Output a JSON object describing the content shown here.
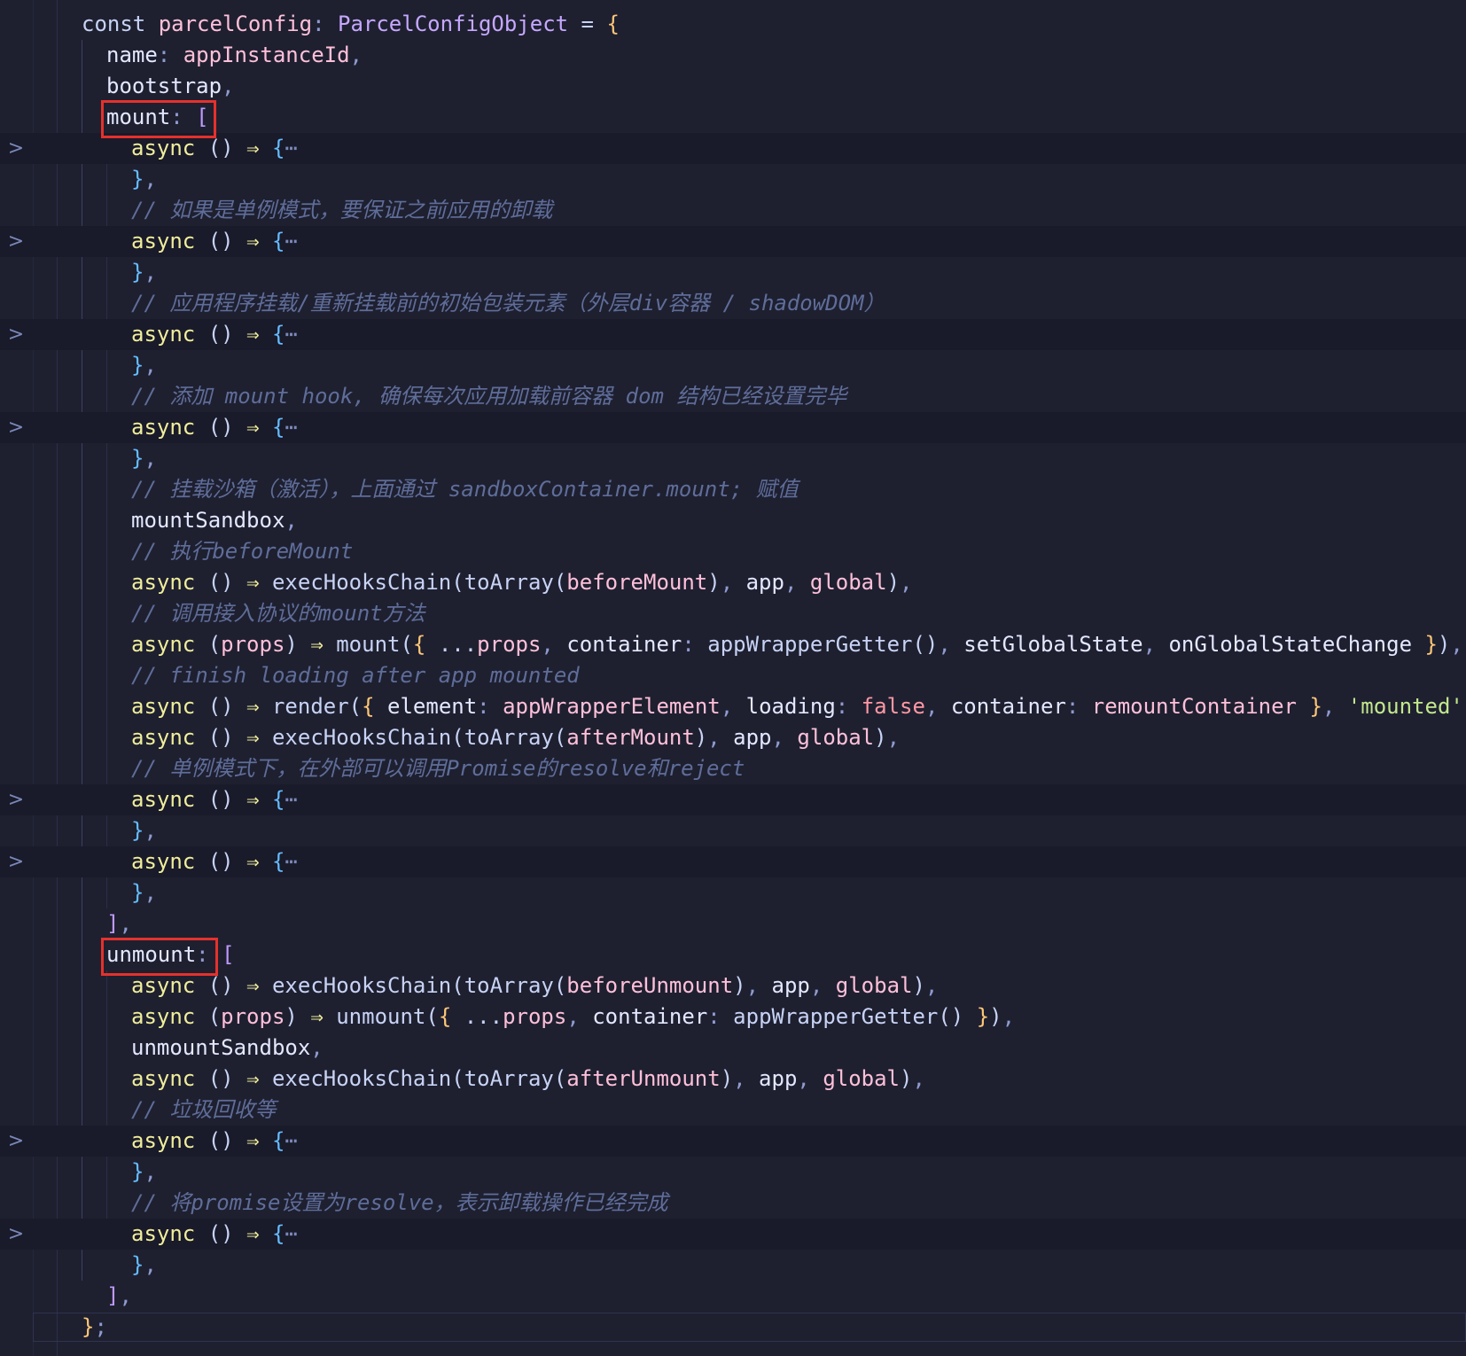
{
  "editor": {
    "lines": [
      {
        "fold": false,
        "indent": 0,
        "tokens": [
          [
            "k",
            "const "
          ],
          [
            "id",
            "parcelConfig"
          ],
          [
            "p",
            ": "
          ],
          [
            "ty",
            "ParcelConfigObject"
          ],
          [
            "k",
            " = "
          ],
          [
            "bk",
            "{"
          ]
        ]
      },
      {
        "fold": false,
        "indent": 1,
        "tokens": [
          [
            "txt-w",
            "name"
          ],
          [
            "p",
            ": "
          ],
          [
            "id",
            "appInstanceId"
          ],
          [
            "p",
            ","
          ]
        ]
      },
      {
        "fold": false,
        "indent": 1,
        "tokens": [
          [
            "txt-w",
            "bootstrap"
          ],
          [
            "p",
            ","
          ]
        ]
      },
      {
        "fold": false,
        "indent": 1,
        "tokens": [
          [
            "txt-w",
            "mount"
          ],
          [
            "p",
            ": "
          ],
          [
            "bk2",
            "["
          ]
        ]
      },
      {
        "fold": true,
        "indent": 2,
        "tokens": [
          [
            "kw",
            "async "
          ],
          [
            "k",
            "() "
          ],
          [
            "arrow",
            "⇒"
          ],
          [
            "k",
            " "
          ],
          [
            "bk3",
            "{"
          ],
          [
            "ell",
            "⋯"
          ]
        ]
      },
      {
        "fold": false,
        "indent": 2,
        "tokens": [
          [
            "bk3",
            "}"
          ],
          [
            "p",
            ","
          ]
        ]
      },
      {
        "fold": false,
        "indent": 2,
        "tokens": [
          [
            "cm",
            "// 如果是单例模式，要保证之前应用的卸载"
          ]
        ]
      },
      {
        "fold": true,
        "indent": 2,
        "tokens": [
          [
            "kw",
            "async "
          ],
          [
            "k",
            "() "
          ],
          [
            "arrow",
            "⇒"
          ],
          [
            "k",
            " "
          ],
          [
            "bk3",
            "{"
          ],
          [
            "ell",
            "⋯"
          ]
        ]
      },
      {
        "fold": false,
        "indent": 2,
        "tokens": [
          [
            "bk3",
            "}"
          ],
          [
            "p",
            ","
          ]
        ]
      },
      {
        "fold": false,
        "indent": 2,
        "tokens": [
          [
            "cm",
            "// 应用程序挂载/重新挂载前的初始包装元素（外层div容器 / shadowDOM）"
          ]
        ]
      },
      {
        "fold": true,
        "indent": 2,
        "tokens": [
          [
            "kw",
            "async "
          ],
          [
            "k",
            "() "
          ],
          [
            "arrow",
            "⇒"
          ],
          [
            "k",
            " "
          ],
          [
            "bk3",
            "{"
          ],
          [
            "ell",
            "⋯"
          ]
        ]
      },
      {
        "fold": false,
        "indent": 2,
        "tokens": [
          [
            "bk3",
            "}"
          ],
          [
            "p",
            ","
          ]
        ]
      },
      {
        "fold": false,
        "indent": 2,
        "tokens": [
          [
            "cm",
            "// 添加 mount hook, 确保每次应用加载前容器 dom 结构已经设置完毕"
          ]
        ]
      },
      {
        "fold": true,
        "indent": 2,
        "tokens": [
          [
            "kw",
            "async "
          ],
          [
            "k",
            "() "
          ],
          [
            "arrow",
            "⇒"
          ],
          [
            "k",
            " "
          ],
          [
            "bk3",
            "{"
          ],
          [
            "ell",
            "⋯"
          ]
        ]
      },
      {
        "fold": false,
        "indent": 2,
        "tokens": [
          [
            "bk3",
            "}"
          ],
          [
            "p",
            ","
          ]
        ]
      },
      {
        "fold": false,
        "indent": 2,
        "tokens": [
          [
            "cm",
            "// 挂载沙箱（激活），上面通过 sandboxContainer.mount; 赋值"
          ]
        ]
      },
      {
        "fold": false,
        "indent": 2,
        "tokens": [
          [
            "txt-w",
            "mountSandbox"
          ],
          [
            "p",
            ","
          ]
        ]
      },
      {
        "fold": false,
        "indent": 2,
        "tokens": [
          [
            "cm",
            "// 执行beforeMount"
          ]
        ]
      },
      {
        "fold": false,
        "indent": 2,
        "tokens": [
          [
            "kw",
            "async "
          ],
          [
            "k",
            "() "
          ],
          [
            "arrow",
            "⇒"
          ],
          [
            "k",
            " execHooksChain(toArray("
          ],
          [
            "id",
            "beforeMount"
          ],
          [
            "k",
            ")"
          ],
          [
            "p",
            ", "
          ],
          [
            "txt-w",
            "app"
          ],
          [
            "p",
            ", "
          ],
          [
            "id",
            "global"
          ],
          [
            "k",
            ")"
          ],
          [
            "p",
            ","
          ]
        ]
      },
      {
        "fold": false,
        "indent": 2,
        "tokens": [
          [
            "cm",
            "// 调用接入协议的mount方法"
          ]
        ]
      },
      {
        "fold": false,
        "indent": 2,
        "tokens": [
          [
            "kw",
            "async "
          ],
          [
            "k",
            "("
          ],
          [
            "id",
            "props"
          ],
          [
            "k",
            ") "
          ],
          [
            "arrow",
            "⇒"
          ],
          [
            "k",
            " mount("
          ],
          [
            "bk",
            "{"
          ],
          [
            "k",
            " ..."
          ],
          [
            "id",
            "props"
          ],
          [
            "p",
            ", "
          ],
          [
            "txt-w",
            "container"
          ],
          [
            "p",
            ": "
          ],
          [
            "k",
            "appWrapperGetter()"
          ],
          [
            "p",
            ", "
          ],
          [
            "txt-w",
            "setGlobalState"
          ],
          [
            "p",
            ", "
          ],
          [
            "txt-w",
            "onGlobalStateChange "
          ],
          [
            "bk",
            "}"
          ],
          [
            "k",
            ")"
          ],
          [
            "p",
            ","
          ]
        ]
      },
      {
        "fold": false,
        "indent": 2,
        "tokens": [
          [
            "cm",
            "// finish loading after app mounted"
          ]
        ]
      },
      {
        "fold": false,
        "indent": 2,
        "tokens": [
          [
            "kw",
            "async "
          ],
          [
            "k",
            "() "
          ],
          [
            "arrow",
            "⇒"
          ],
          [
            "k",
            " render("
          ],
          [
            "bk",
            "{"
          ],
          [
            "k",
            " "
          ],
          [
            "txt-w",
            "element"
          ],
          [
            "p",
            ": "
          ],
          [
            "id",
            "appWrapperElement"
          ],
          [
            "p",
            ", "
          ],
          [
            "txt-w",
            "loading"
          ],
          [
            "p",
            ": "
          ],
          [
            "bool",
            "false"
          ],
          [
            "p",
            ", "
          ],
          [
            "txt-w",
            "container"
          ],
          [
            "p",
            ": "
          ],
          [
            "id",
            "remountContainer "
          ],
          [
            "bk",
            "}"
          ],
          [
            "p",
            ", "
          ],
          [
            "st",
            "'mounted'"
          ],
          [
            "k",
            ")"
          ],
          [
            "p",
            ","
          ]
        ]
      },
      {
        "fold": false,
        "indent": 2,
        "tokens": [
          [
            "kw",
            "async "
          ],
          [
            "k",
            "() "
          ],
          [
            "arrow",
            "⇒"
          ],
          [
            "k",
            " execHooksChain(toArray("
          ],
          [
            "id",
            "afterMount"
          ],
          [
            "k",
            ")"
          ],
          [
            "p",
            ", "
          ],
          [
            "txt-w",
            "app"
          ],
          [
            "p",
            ", "
          ],
          [
            "id",
            "global"
          ],
          [
            "k",
            ")"
          ],
          [
            "p",
            ","
          ]
        ]
      },
      {
        "fold": false,
        "indent": 2,
        "tokens": [
          [
            "cm",
            "// 单例模式下，在外部可以调用Promise的resolve和reject"
          ]
        ]
      },
      {
        "fold": true,
        "indent": 2,
        "tokens": [
          [
            "kw",
            "async "
          ],
          [
            "k",
            "() "
          ],
          [
            "arrow",
            "⇒"
          ],
          [
            "k",
            " "
          ],
          [
            "bk3",
            "{"
          ],
          [
            "ell",
            "⋯"
          ]
        ]
      },
      {
        "fold": false,
        "indent": 2,
        "tokens": [
          [
            "bk3",
            "}"
          ],
          [
            "p",
            ","
          ]
        ]
      },
      {
        "fold": true,
        "indent": 2,
        "tokens": [
          [
            "kw",
            "async "
          ],
          [
            "k",
            "() "
          ],
          [
            "arrow",
            "⇒"
          ],
          [
            "k",
            " "
          ],
          [
            "bk3",
            "{"
          ],
          [
            "ell",
            "⋯"
          ]
        ]
      },
      {
        "fold": false,
        "indent": 2,
        "tokens": [
          [
            "bk3",
            "}"
          ],
          [
            "p",
            ","
          ]
        ]
      },
      {
        "fold": false,
        "indent": 1,
        "tokens": [
          [
            "bk2",
            "]"
          ],
          [
            "p",
            ","
          ]
        ]
      },
      {
        "fold": false,
        "indent": 1,
        "tokens": [
          [
            "txt-w",
            "unmount"
          ],
          [
            "p",
            ": "
          ],
          [
            "bk2",
            "["
          ]
        ]
      },
      {
        "fold": false,
        "indent": 2,
        "tokens": [
          [
            "kw",
            "async "
          ],
          [
            "k",
            "() "
          ],
          [
            "arrow",
            "⇒"
          ],
          [
            "k",
            " execHooksChain(toArray("
          ],
          [
            "id",
            "beforeUnmount"
          ],
          [
            "k",
            ")"
          ],
          [
            "p",
            ", "
          ],
          [
            "txt-w",
            "app"
          ],
          [
            "p",
            ", "
          ],
          [
            "id",
            "global"
          ],
          [
            "k",
            ")"
          ],
          [
            "p",
            ","
          ]
        ]
      },
      {
        "fold": false,
        "indent": 2,
        "tokens": [
          [
            "kw",
            "async "
          ],
          [
            "k",
            "("
          ],
          [
            "id",
            "props"
          ],
          [
            "k",
            ") "
          ],
          [
            "arrow",
            "⇒"
          ],
          [
            "k",
            " unmount("
          ],
          [
            "bk",
            "{"
          ],
          [
            "k",
            " ..."
          ],
          [
            "id",
            "props"
          ],
          [
            "p",
            ", "
          ],
          [
            "txt-w",
            "container"
          ],
          [
            "p",
            ": "
          ],
          [
            "k",
            "appWrapperGetter() "
          ],
          [
            "bk",
            "}"
          ],
          [
            "k",
            ")"
          ],
          [
            "p",
            ","
          ]
        ]
      },
      {
        "fold": false,
        "indent": 2,
        "tokens": [
          [
            "txt-w",
            "unmountSandbox"
          ],
          [
            "p",
            ","
          ]
        ]
      },
      {
        "fold": false,
        "indent": 2,
        "tokens": [
          [
            "kw",
            "async "
          ],
          [
            "k",
            "() "
          ],
          [
            "arrow",
            "⇒"
          ],
          [
            "k",
            " execHooksChain(toArray("
          ],
          [
            "id",
            "afterUnmount"
          ],
          [
            "k",
            ")"
          ],
          [
            "p",
            ", "
          ],
          [
            "txt-w",
            "app"
          ],
          [
            "p",
            ", "
          ],
          [
            "id",
            "global"
          ],
          [
            "k",
            ")"
          ],
          [
            "p",
            ","
          ]
        ]
      },
      {
        "fold": false,
        "indent": 2,
        "tokens": [
          [
            "cm",
            "// 垃圾回收等"
          ]
        ]
      },
      {
        "fold": true,
        "indent": 2,
        "tokens": [
          [
            "kw",
            "async "
          ],
          [
            "k",
            "() "
          ],
          [
            "arrow",
            "⇒"
          ],
          [
            "k",
            " "
          ],
          [
            "bk3",
            "{"
          ],
          [
            "ell",
            "⋯"
          ]
        ]
      },
      {
        "fold": false,
        "indent": 2,
        "tokens": [
          [
            "bk3",
            "}"
          ],
          [
            "p",
            ","
          ]
        ]
      },
      {
        "fold": false,
        "indent": 2,
        "tokens": [
          [
            "cm",
            "// 将promise设置为resolve，表示卸载操作已经完成"
          ]
        ]
      },
      {
        "fold": true,
        "indent": 2,
        "tokens": [
          [
            "kw",
            "async "
          ],
          [
            "k",
            "() "
          ],
          [
            "arrow",
            "⇒"
          ],
          [
            "k",
            " "
          ],
          [
            "bk3",
            "{"
          ],
          [
            "ell",
            "⋯"
          ]
        ]
      },
      {
        "fold": false,
        "indent": 2,
        "tokens": [
          [
            "bk3",
            "}"
          ],
          [
            "p",
            ","
          ]
        ]
      },
      {
        "fold": false,
        "indent": 1,
        "tokens": [
          [
            "bk2",
            "]"
          ],
          [
            "p",
            ","
          ]
        ]
      },
      {
        "fold": false,
        "indent": 0,
        "current": true,
        "tokens": [
          [
            "bk",
            "}"
          ],
          [
            "p",
            ";"
          ]
        ]
      }
    ],
    "fold_glyph": ">",
    "highlight_color": "#e5312c"
  }
}
